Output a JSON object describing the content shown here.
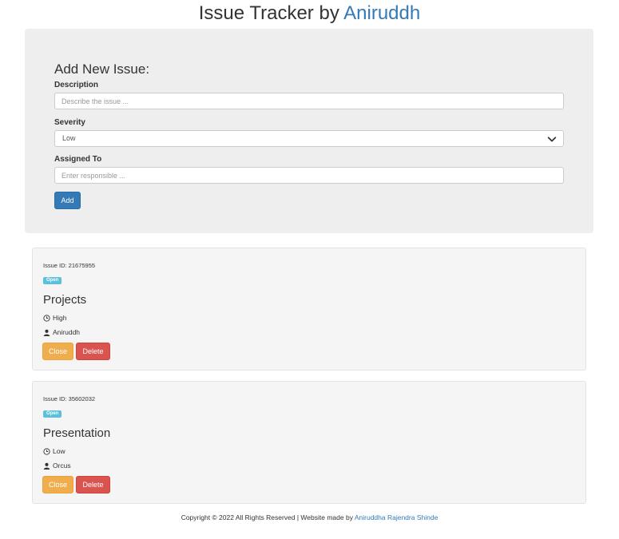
{
  "header": {
    "title_prefix": "Issue Tracker by",
    "title_link": "Aniruddh"
  },
  "form": {
    "heading": "Add New Issue:",
    "description": {
      "label": "Description",
      "placeholder": "Describe the issue ...",
      "value": ""
    },
    "severity": {
      "label": "Severity",
      "selected": "Low"
    },
    "assigned_to": {
      "label": "Assigned To",
      "placeholder": "Enter responsible ...",
      "value": ""
    },
    "add_label": "Add"
  },
  "issues": [
    {
      "id_text": "Issue ID: 21675955",
      "status": "Open",
      "title": "Projects",
      "severity": "High",
      "assignee": "Aniruddh",
      "close_label": "Close",
      "delete_label": "Delete"
    },
    {
      "id_text": "Issue ID: 35602032",
      "status": "Open",
      "title": "Presentation",
      "severity": "Low",
      "assignee": "Orcus",
      "close_label": "Close",
      "delete_label": "Delete"
    }
  ],
  "footer": {
    "text": "Copyright © 2022 All Rights Reserved | Website made by",
    "link": "Aniruddha Rajendra Shinde"
  },
  "colors": {
    "primary": "#337ab7",
    "warning": "#f0ad4e",
    "danger": "#d9534f",
    "info": "#5bc0de",
    "panel_bg": "#eeeeee",
    "card_bg": "#f5f5f5"
  }
}
